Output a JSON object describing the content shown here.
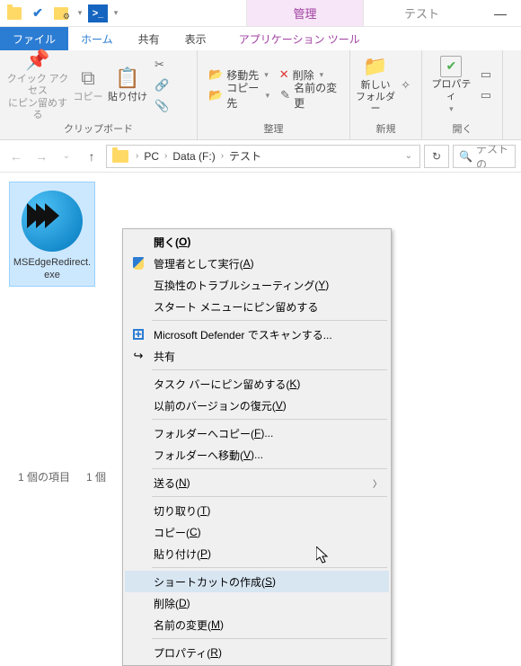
{
  "titlebar": {
    "tabs": {
      "manage": "管理",
      "main": "テスト"
    }
  },
  "menubar": {
    "file": "ファイル",
    "home": "ホーム",
    "share": "共有",
    "view": "表示",
    "apptools": "アプリケーション ツール"
  },
  "ribbon": {
    "clipboard": {
      "pin1": "クイック アクセス",
      "pin2": "にピン留めする",
      "copy": "コピー",
      "paste": "貼り付け",
      "cut_icon": "✂",
      "path_icon": "📋",
      "link_icon": "📋",
      "label": "クリップボード"
    },
    "organize": {
      "move": "移動先",
      "copyto": "コピー先",
      "delete": "削除",
      "rename": "名前の変更",
      "label": "整理"
    },
    "new": {
      "l1": "新しい",
      "l2": "フォルダー",
      "label": "新規"
    },
    "open": {
      "prop": "プロパティ",
      "label": "開く"
    }
  },
  "address": {
    "crumbs": [
      "PC",
      "Data (F:)",
      "テスト"
    ],
    "search_placeholder": "テストの"
  },
  "file": {
    "name1": "MSEdgeRedirect.",
    "name2": "exe"
  },
  "status": {
    "count": "1 個の項目",
    "selected": "1 個"
  },
  "context": {
    "open": "開く(O)",
    "runas": "管理者として実行(A)",
    "compat": "互換性のトラブルシューティング(Y)",
    "pinstart": "スタート メニューにピン留めする",
    "defender": "Microsoft Defender でスキャンする...",
    "share": "共有",
    "pintask": "タスク バーにピン留めする(K)",
    "restore": "以前のバージョンの復元(V)",
    "copyfolder": "フォルダーへコピー(F)...",
    "movefolder": "フォルダーへ移動(V)...",
    "sendto": "送る(N)",
    "cut": "切り取り(T)",
    "copy": "コピー(C)",
    "paste": "貼り付け(P)",
    "shortcut": "ショートカットの作成(S)",
    "delete": "削除(D)",
    "rename": "名前の変更(M)",
    "properties": "プロパティ(R)"
  }
}
